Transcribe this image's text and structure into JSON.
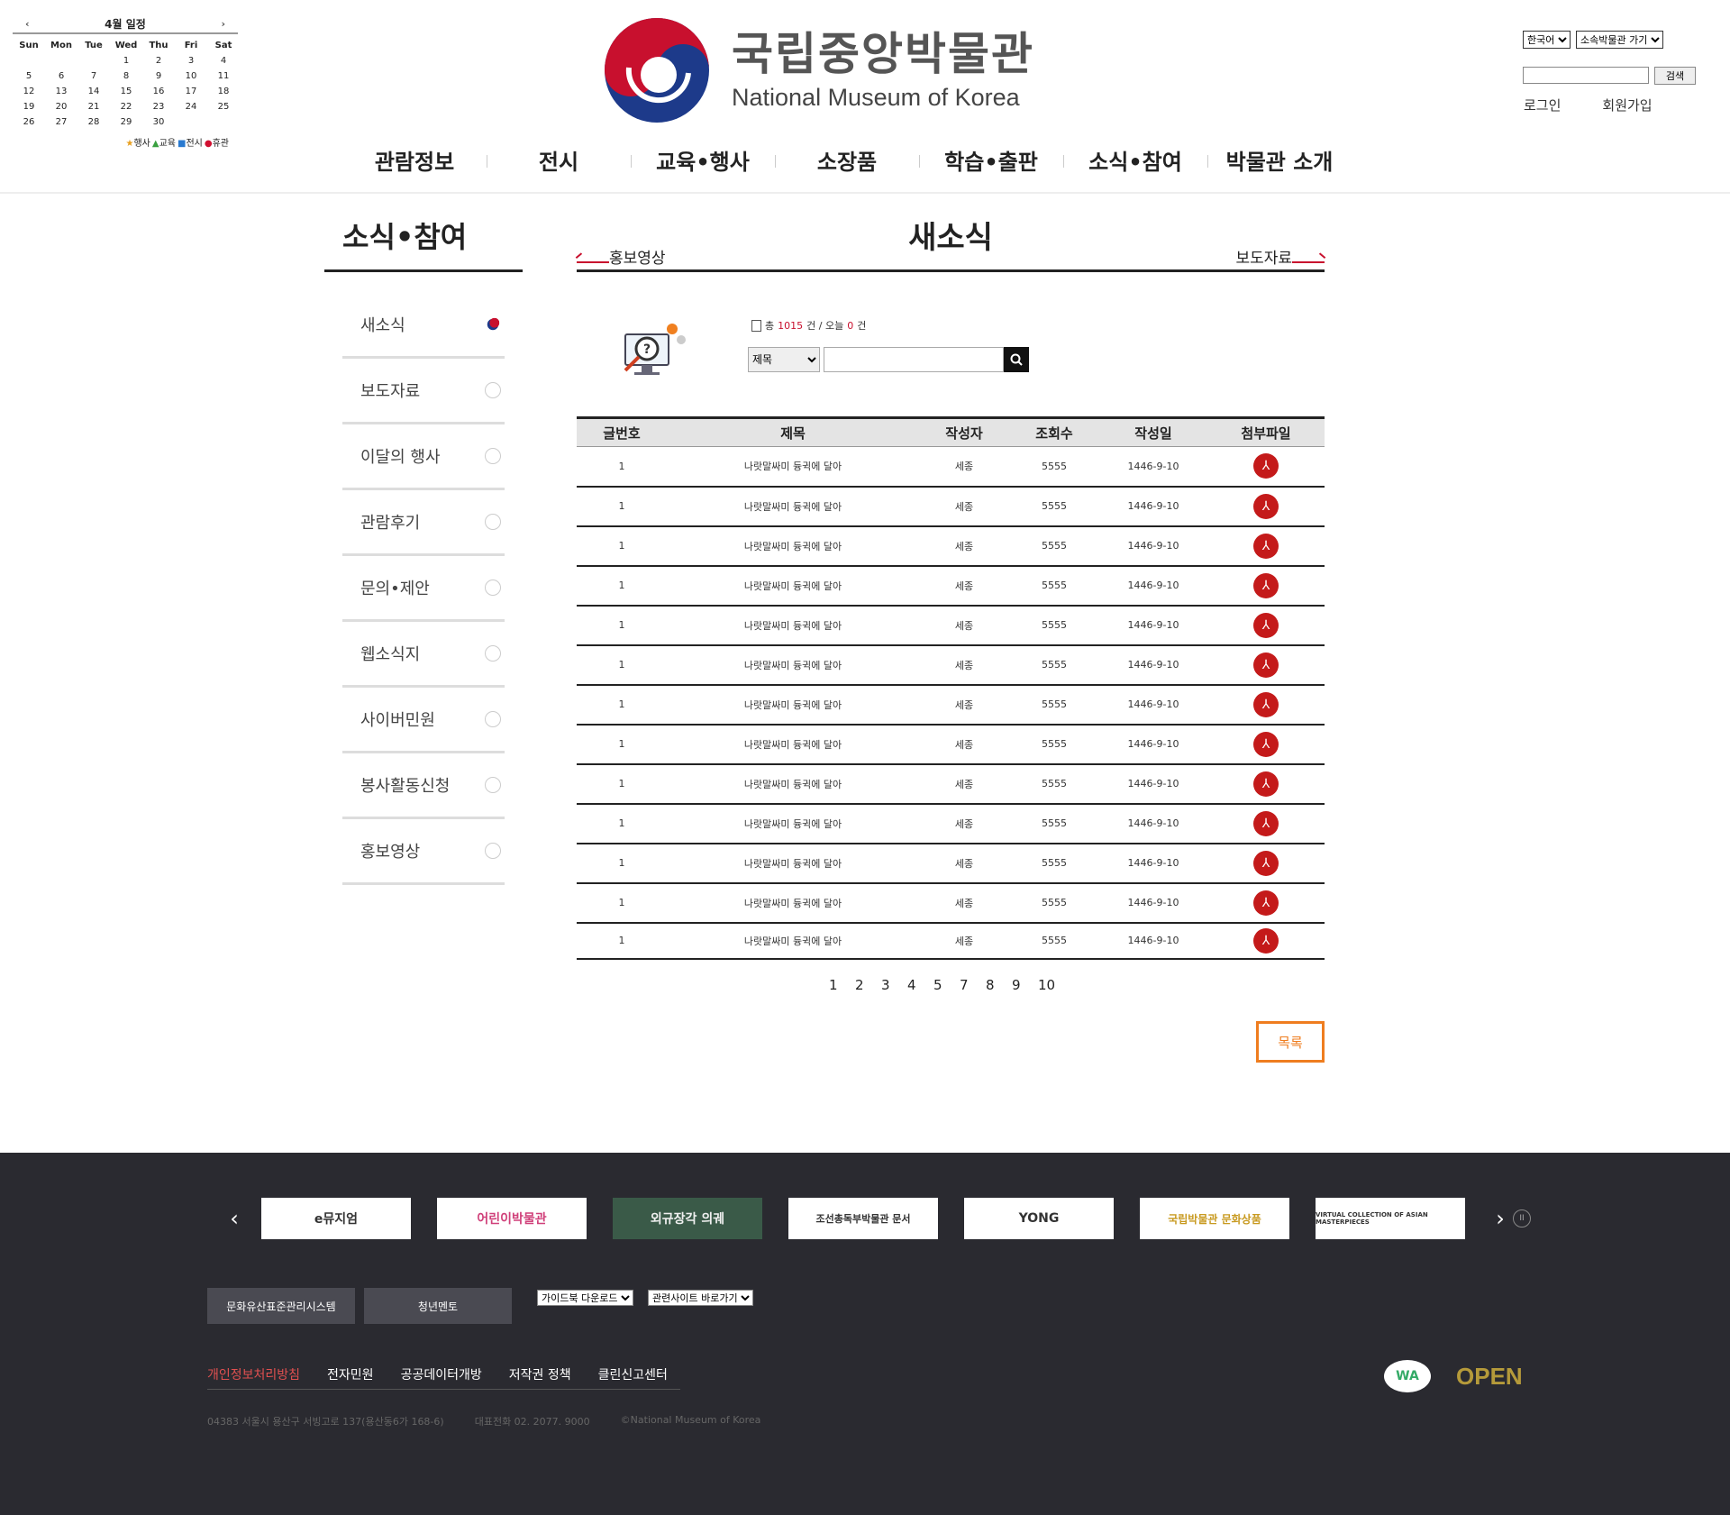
{
  "calendar": {
    "title": "4월 일정",
    "prev": "‹",
    "next": "›",
    "weekdays": [
      "Sun",
      "Mon",
      "Tue",
      "Wed",
      "Thu",
      "Fri",
      "Sat"
    ],
    "days": [
      "",
      "",
      "",
      "1",
      "2",
      "3",
      "4",
      "5",
      "6",
      "7",
      "8",
      "9",
      "10",
      "11",
      "12",
      "13",
      "14",
      "15",
      "16",
      "17",
      "18",
      "19",
      "20",
      "21",
      "22",
      "23",
      "24",
      "25",
      "26",
      "27",
      "28",
      "29",
      "30",
      "",
      ""
    ],
    "legend": [
      {
        "icon": "star-icon",
        "symbol": "★",
        "label": "행사",
        "color": "#e8a020"
      },
      {
        "icon": "triangle-icon",
        "symbol": "▲",
        "label": "교육",
        "color": "#3aa040"
      },
      {
        "icon": "square-icon",
        "symbol": "■",
        "label": "전시",
        "color": "#2a7ad0"
      },
      {
        "icon": "circle-icon",
        "symbol": "●",
        "label": "휴관",
        "color": "#d01030"
      }
    ]
  },
  "logo": {
    "ko": "국립중앙박물관",
    "en": "National Museum of Korea"
  },
  "util": {
    "language": "한국어",
    "affiliate": "소속박물관 가기",
    "search_button": "검색",
    "login": "로그인",
    "signup": "회원가입"
  },
  "gnb": [
    "관람정보",
    "전시",
    "교육•행사",
    "소장품",
    "학습•출판",
    "소식•참여",
    "박물관 소개"
  ],
  "lnb": {
    "title": "소식•참여",
    "items": [
      "새소식",
      "보도자료",
      "이달의 행사",
      "관람후기",
      "문의•제안",
      "웹소식지",
      "사이버민원",
      "봉사활동신청",
      "홍보영상"
    ]
  },
  "content": {
    "title": "새소식",
    "prev": "홍보영상",
    "next": "보도자료",
    "count_prefix": "총",
    "total": "1015",
    "count_mid": "건 / 오늘",
    "today": "0",
    "count_suffix": "건",
    "search_field": "제목"
  },
  "table": {
    "headers": [
      "글번호",
      "제목",
      "작성자",
      "조회수",
      "작성일",
      "첨부파일"
    ],
    "rows": [
      {
        "no": "1",
        "title": "나랏말싸미 듕귁에 달아",
        "author": "세종",
        "views": "5555",
        "date": "1446-9-10"
      },
      {
        "no": "1",
        "title": "나랏말싸미 듕귁에 달아",
        "author": "세종",
        "views": "5555",
        "date": "1446-9-10"
      },
      {
        "no": "1",
        "title": "나랏말싸미 듕귁에 달아",
        "author": "세종",
        "views": "5555",
        "date": "1446-9-10"
      },
      {
        "no": "1",
        "title": "나랏말싸미 듕귁에 달아",
        "author": "세종",
        "views": "5555",
        "date": "1446-9-10"
      },
      {
        "no": "1",
        "title": "나랏말싸미 듕귁에 달아",
        "author": "세종",
        "views": "5555",
        "date": "1446-9-10"
      },
      {
        "no": "1",
        "title": "나랏말싸미 듕귁에 달아",
        "author": "세종",
        "views": "5555",
        "date": "1446-9-10"
      },
      {
        "no": "1",
        "title": "나랏말싸미 듕귁에 달아",
        "author": "세종",
        "views": "5555",
        "date": "1446-9-10"
      },
      {
        "no": "1",
        "title": "나랏말싸미 듕귁에 달아",
        "author": "세종",
        "views": "5555",
        "date": "1446-9-10"
      },
      {
        "no": "1",
        "title": "나랏말싸미 듕귁에 달아",
        "author": "세종",
        "views": "5555",
        "date": "1446-9-10"
      },
      {
        "no": "1",
        "title": "나랏말싸미 듕귁에 달아",
        "author": "세종",
        "views": "5555",
        "date": "1446-9-10"
      },
      {
        "no": "1",
        "title": "나랏말싸미 듕귁에 달아",
        "author": "세종",
        "views": "5555",
        "date": "1446-9-10"
      },
      {
        "no": "1",
        "title": "나랏말싸미 듕귁에 달아",
        "author": "세종",
        "views": "5555",
        "date": "1446-9-10"
      },
      {
        "no": "1",
        "title": "나랏말싸미 듕귁에 달아",
        "author": "세종",
        "views": "5555",
        "date": "1446-9-10"
      }
    ]
  },
  "pager": [
    "1",
    "2",
    "3",
    "4",
    "5",
    "7",
    "8",
    "9",
    "10"
  ],
  "list_button": "목록",
  "footer": {
    "banners": [
      "e뮤지엄",
      "어린이박물관",
      "외규장각 의궤",
      "조선총독부박물관 문서",
      "YONG",
      "국립박물관 문화상품",
      "VIRTUAL COLLECTION OF ASIAN MASTERPIECES"
    ],
    "buttons": [
      "문화유산표준관리시스템",
      "청년멘토"
    ],
    "guidebook": "가이드북 다운로드",
    "related": "관련사이트 바로가기",
    "links": [
      "개인정보처리방침",
      "전자민원",
      "공공데이터개방",
      "저작권 정책",
      "클린신고센터"
    ],
    "address": "04383 서울시 용산구 서빙고로 137(용산동6가 168-6)",
    "phone": "대표전화 02. 2077. 9000",
    "copyright": "©National Museum of Korea",
    "accent": "#e05050"
  }
}
